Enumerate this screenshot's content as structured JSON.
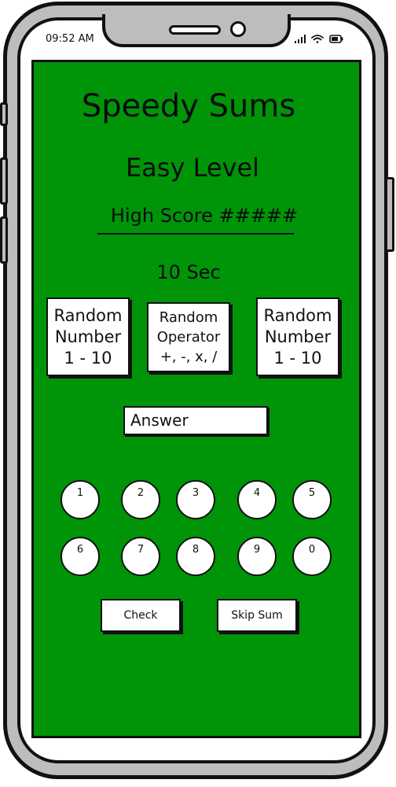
{
  "status_bar": {
    "time": "09:52 AM"
  },
  "game": {
    "title": "Speedy Sums",
    "level": "Easy Level",
    "high_score": "High Score #####",
    "timer": "10 Sec"
  },
  "cards": [
    {
      "line1": "Random",
      "line2": "Number",
      "line3": "1 - 10"
    },
    {
      "line1": "Random",
      "line2": "Operator",
      "line3": "+, -, x, /"
    },
    {
      "line1": "Random",
      "line2": "Number",
      "line3": "1 - 10"
    }
  ],
  "answer": {
    "placeholder": "Answer"
  },
  "keypad": [
    "1",
    "2",
    "3",
    "4",
    "5",
    "6",
    "7",
    "8",
    "9",
    "0"
  ],
  "buttons": {
    "check": "Check",
    "skip": "Skip Sum"
  },
  "colors": {
    "screen": "#009409",
    "shell": "#bdbdbd",
    "outline": "#111111"
  }
}
